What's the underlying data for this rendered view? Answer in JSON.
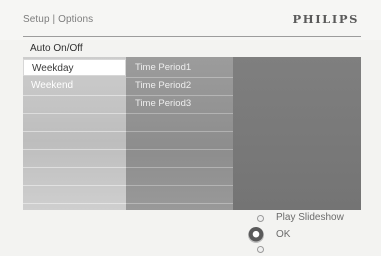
{
  "header": {
    "breadcrumb": "Setup | Options",
    "brand": "PHILIPS"
  },
  "section_title": "Auto On/Off",
  "menu": {
    "col1": [
      {
        "label": "Weekday",
        "selected": true
      },
      {
        "label": "Weekend",
        "selected": false
      }
    ],
    "col2": [
      {
        "label": "Time Period1"
      },
      {
        "label": "Time Period2"
      },
      {
        "label": "Time Period3"
      }
    ]
  },
  "controls": {
    "up_label": "Play Slideshow",
    "ok_label": "OK"
  }
}
